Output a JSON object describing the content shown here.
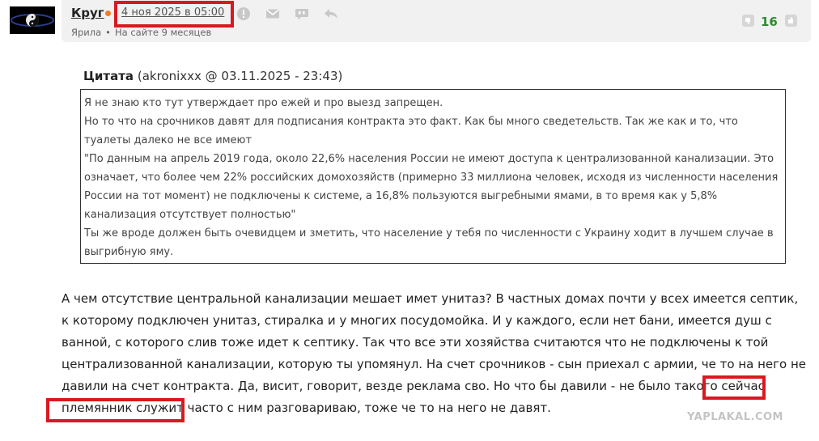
{
  "post": {
    "username": "Круг",
    "date": "4 ноя 2025 в 05:00",
    "location": "Ярила",
    "on_site": "На сайте 9 месяцев",
    "rating": "16"
  },
  "quote": {
    "label": "Цитата",
    "source": "(akronixxx @ 03.11.2025 - 23:43)",
    "lines": [
      "Я не знаю кто тут утверждает про ежей и про выезд запрещен.",
      "Но то что на срочников давят для подписания контракта это факт. Как бы много сведетельств. Так же как и то, что туалеты далеко не все имеют",
      "\"По данным на апрель 2019 года, около 22,6% населения России не имеют доступа к централизованной канализации. Это означает, что более чем 22% российских домохозяйств (примерно 33 миллиона человек, исходя из численности населения России на тот момент) не подключены к системе, а 16,8% пользуются выгребными ямами, в то время как у 5,8% канализация отсутствует полностью\"",
      "Ты же вроде должен быть очевидцем и зметить, что население у тебя по численности с Украину ходит в лучшем случае в выгрибную яму."
    ]
  },
  "body": {
    "text": "А чем отсутствие центральной канализации мешает имет унитаз? В частных домах почти у всех имеется септик, к которому подключен унитаз, стиралка и у многих посудомойка. И у каждого, если нет бани, имеется душ с ванной, с которого слив тоже идет к септику. Так что все эти хозяйства считаются что не подключены к той централизованной канализации, которую ты упомянул. На счет срочников - сын приехал с армии, че то на него не давили на счет контракта. Да, висит, говорит, везде реклама сво. Но что бы давили - не было такого сейчас племянник служит часто с ним разговариваю, тоже че то на него не давят."
  },
  "watermark": "YAPLAKAL.COM",
  "icons": {
    "report": "exclamation-circle-icon",
    "message": "envelope-icon",
    "quote": "quote-bubble-icon",
    "reply": "reply-arrow-icon",
    "vote_down": "thumbs-down-icon",
    "vote_up": "thumbs-up-icon"
  },
  "colors": {
    "highlight_box": "#d9191f",
    "rating": "#2e8b2e",
    "online": "#f07c2a"
  }
}
